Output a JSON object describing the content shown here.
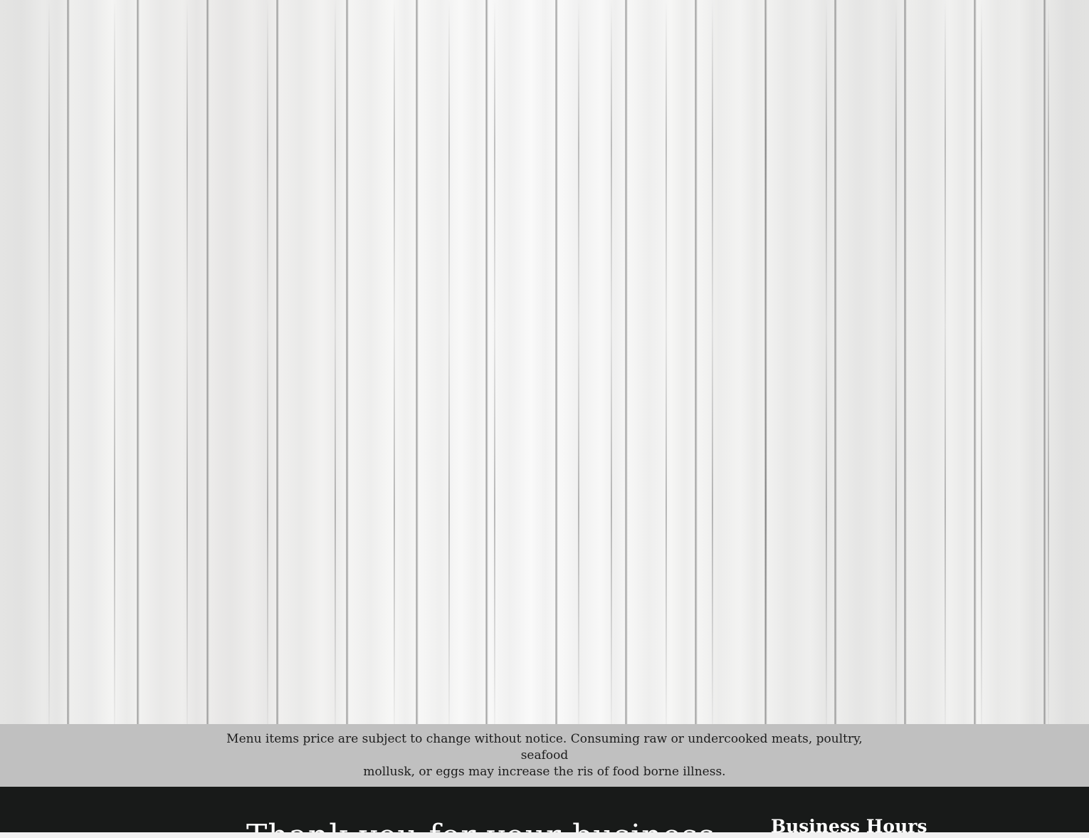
{
  "notice": {
    "line1": "Menu items price are subject to change without notice.  Consuming raw or undercooked meats, poultry, seafood",
    "line2": "mollusk, or eggs may increase the ris of food borne illness."
  },
  "footer": {
    "thanks": "Thank you for your business",
    "hours_heading": "Business Hours"
  },
  "colors": {
    "notice_band": "#c0c0c0",
    "footer_background": "#181a19",
    "footer_text": "#ffffff"
  }
}
